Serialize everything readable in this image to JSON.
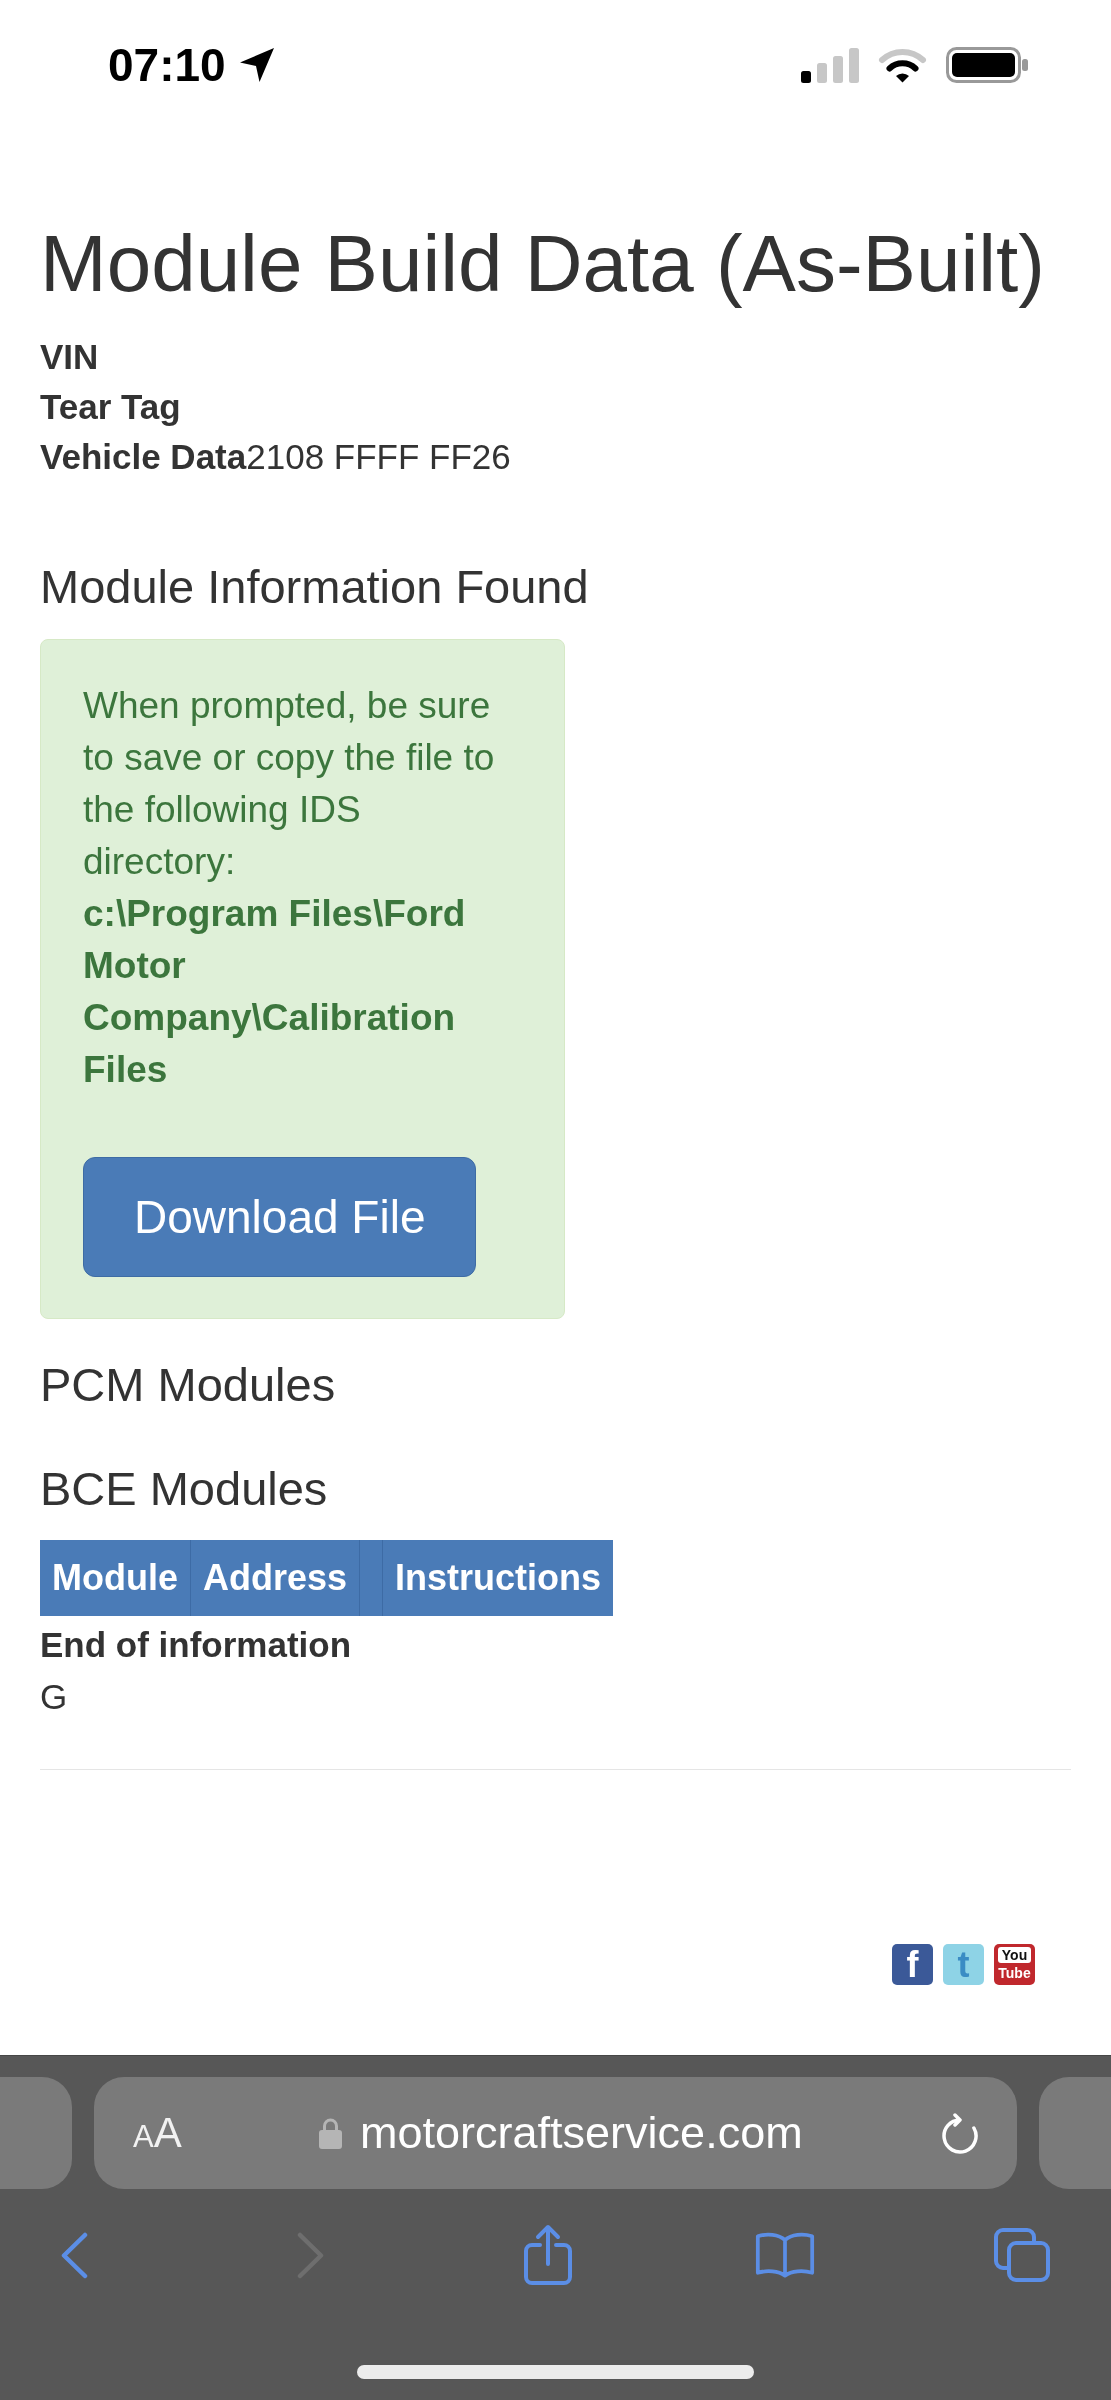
{
  "status_bar": {
    "time": "07:10"
  },
  "page": {
    "title": "Module Build Data (As-Built)",
    "fields": [
      {
        "label": "VIN"
      },
      {
        "label": "Tear Tag"
      },
      {
        "label": "Vehicle Data",
        "value": "2108 FFFF FF26"
      }
    ],
    "section_title": "Module Information Found",
    "notice": {
      "message": "When prompted, be sure to save or copy the file to the following IDS directory:",
      "directory": "c:\\Program Files\\Ford Motor Company\\Calibration Files",
      "button": "Download File"
    },
    "module_sections": [
      {
        "title": "PCM Modules"
      },
      {
        "title": "BCE Modules",
        "table": {
          "columns": [
            {
              "kind": "text",
              "label": "Module"
            },
            {
              "kind": "text",
              "label": "Address"
            },
            {
              "kind": "blank"
            },
            {
              "kind": "text",
              "label": "Instructions"
            }
          ]
        }
      }
    ],
    "end_note": "End of information",
    "trailing_text": "G",
    "social_links": [
      {
        "kind": "letter",
        "color": "#3b5998",
        "lines": [
          "f"
        ]
      },
      {
        "kind": "letter",
        "color": "#8ed3e6",
        "lines": [
          "t"
        ]
      },
      {
        "kind": "stacked",
        "color": "#c0282d",
        "lines": [
          "You",
          "Tube"
        ]
      }
    ]
  },
  "browser": {
    "reader_label": "AA",
    "url": "motorcraftservice.com",
    "toolbar": [
      {
        "kind": "back",
        "disabled": false
      },
      {
        "kind": "forward",
        "disabled": true
      },
      {
        "kind": "share",
        "disabled": false
      },
      {
        "kind": "bookmarks",
        "disabled": false
      },
      {
        "kind": "tabs",
        "disabled": false
      }
    ]
  }
}
